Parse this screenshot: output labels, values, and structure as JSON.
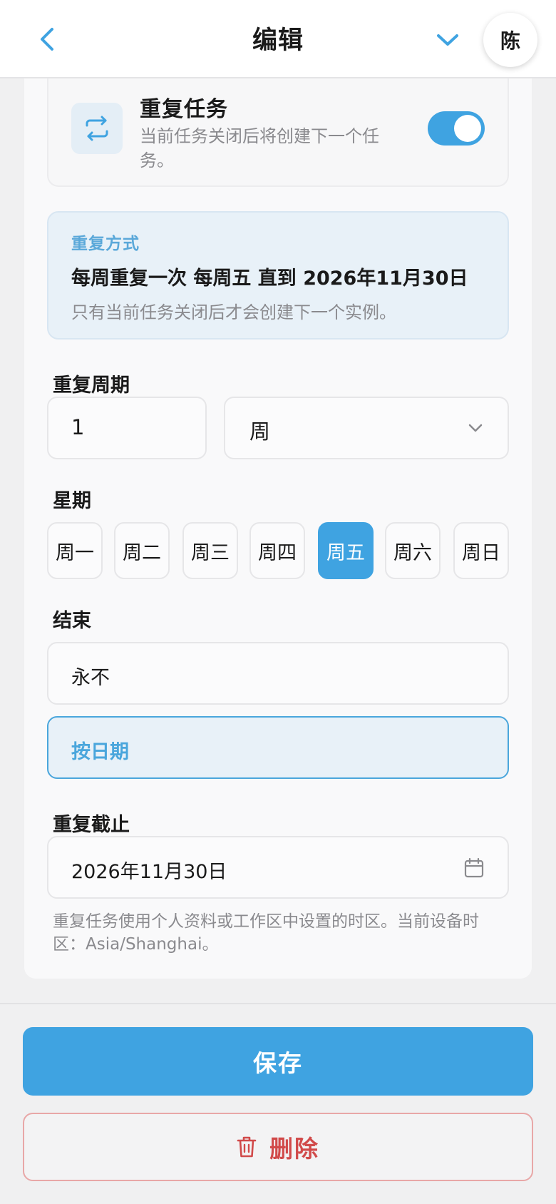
{
  "header": {
    "title": "编辑",
    "avatar_initial": "陈",
    "back_icon": "chevron-left-icon",
    "dropdown_icon": "chevron-down-icon"
  },
  "repeat_task": {
    "title": "重复任务",
    "description": "当前任务关闭后将创建下一个任务。",
    "enabled": true,
    "icon": "repeat-icon"
  },
  "summary": {
    "label": "重复方式",
    "text": "每周重复一次 每周五 直到 2026年11月30日",
    "note": "只有当前任务关闭后才会创建下一个实例。"
  },
  "interval": {
    "label": "重复周期",
    "value": "1",
    "unit": "周"
  },
  "weekdays": {
    "label": "星期",
    "days": [
      "周一",
      "周二",
      "周三",
      "周四",
      "周五",
      "周六",
      "周日"
    ],
    "selected": "周五"
  },
  "end": {
    "label": "结束",
    "options": [
      "永不",
      "按日期"
    ],
    "selected": "按日期"
  },
  "until": {
    "label": "重复截止",
    "value": "2026年11月30日",
    "icon": "calendar-icon"
  },
  "footnote": "重复任务使用个人资料或工作区中设置的时区。当前设备时区：Asia/Shanghai。",
  "actions": {
    "save_label": "保存",
    "delete_label": "删除",
    "delete_icon": "trash-icon"
  },
  "colors": {
    "accent": "#3fa3e1",
    "danger": "#d14a4a",
    "muted_text": "#8a8a8e"
  }
}
